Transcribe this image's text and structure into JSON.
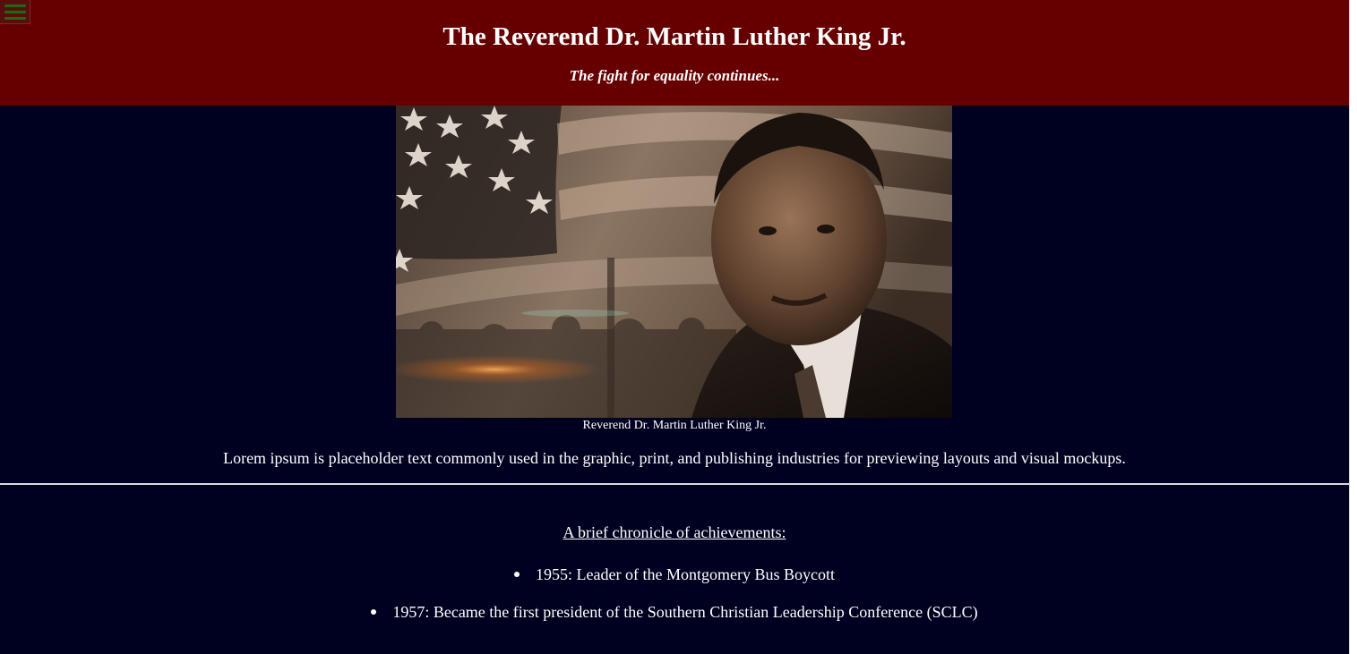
{
  "header": {
    "menu_icon": "hamburger-menu-icon",
    "title": "The Reverend Dr. Martin Luther King Jr.",
    "tagline": "The fight for equality continues..."
  },
  "hero": {
    "image_alt": "Reverend Dr. Martin Luther King Jr.",
    "caption": "Reverend Dr. Martin Luther King Jr."
  },
  "intro": {
    "text": "Lorem ipsum is placeholder text commonly used in the graphic, print, and publishing industries for previewing layouts and visual mockups."
  },
  "chronicle": {
    "heading": "A brief chronicle of achievements:",
    "items": [
      {
        "text": "1955: Leader of the Montgomery Bus Boycott"
      },
      {
        "text": "1957: Became the first president of the Southern Christian Leadership Conference (SCLC)"
      }
    ]
  },
  "colors": {
    "header_bg": "#660000",
    "page_bg": "#000020",
    "text": "#ffffff",
    "menu_icon": "#1c6b12"
  }
}
